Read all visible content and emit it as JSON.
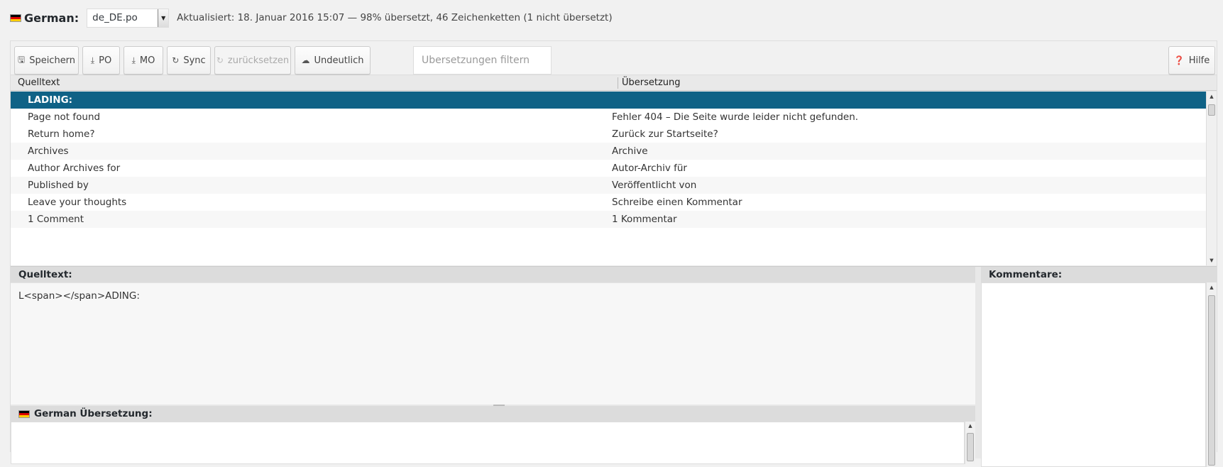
{
  "header": {
    "language": "German:",
    "file": "de_DE.po",
    "status": "Aktualisiert: 18. Januar 2016 15:07 — 98% übersetzt, 46 Zeichenketten (1 nicht übersetzt)"
  },
  "toolbar": {
    "save": "Speichern",
    "po": "PO",
    "mo": "MO",
    "sync": "Sync",
    "revert": "zurücksetzen",
    "fuzzy": "Undeutlich",
    "filter_placeholder": "Übersetzungen filtern",
    "help": "Hilfe"
  },
  "grid": {
    "col_source": "Quelltext",
    "col_translation": "Übersetzung",
    "rows": [
      {
        "source": "LADING:",
        "translation": ""
      },
      {
        "source": "Page not found",
        "translation": "Fehler 404 – Die Seite wurde leider nicht gefunden."
      },
      {
        "source": "Return home?",
        "translation": "Zurück zur Startseite?"
      },
      {
        "source": "Archives",
        "translation": "Archive"
      },
      {
        "source": "Author Archives for",
        "translation": "Autor-Archiv für"
      },
      {
        "source": "Published by",
        "translation": "Veröffentlicht von"
      },
      {
        "source": "Leave your thoughts",
        "translation": "Schreibe einen Kommentar"
      },
      {
        "source": "1 Comment",
        "translation": "1 Kommentar"
      }
    ]
  },
  "source_pane": {
    "title": "Quelltext:",
    "content": "L<span></span>ADING:"
  },
  "translation_pane": {
    "title": "German Übersetzung:"
  },
  "comments_pane": {
    "title": "Kommentare:"
  },
  "colors": {
    "selected_row": "#0f6286",
    "flag": [
      "#000000",
      "#dd0000",
      "#ffcc00"
    ]
  },
  "icons": {
    "save": "floppy-icon",
    "po": "download-icon",
    "mo": "download-icon",
    "sync": "refresh-icon",
    "revert": "undo-icon",
    "fuzzy": "cloud-icon",
    "help": "question-circle-icon"
  }
}
